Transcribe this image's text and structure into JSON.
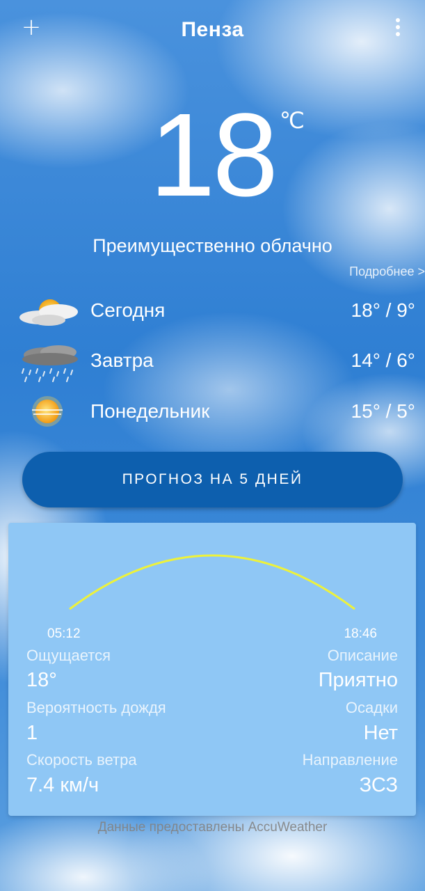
{
  "header": {
    "add_label": "+",
    "city": "Пенза"
  },
  "current": {
    "temperature": "18",
    "unit": "℃",
    "condition": "Преимущественно облачно",
    "details_link": "Подробнее >"
  },
  "forecast": [
    {
      "day": "Сегодня",
      "range": "18° / 9°",
      "icon": "partly-cloudy-sun-icon"
    },
    {
      "day": "Завтра",
      "range": "14° / 6°",
      "icon": "rain-cloud-icon"
    },
    {
      "day": "Понедельник",
      "range": "15° / 5°",
      "icon": "hazy-sun-icon"
    }
  ],
  "forecast_button_label": "ПРОГНОЗ НА 5 ДНЕЙ",
  "details": {
    "sunrise": "05:12",
    "sunset": "18:46",
    "feels_like_label": "Ощущается",
    "feels_like_value": "18°",
    "description_label": "Описание",
    "description_value": "Приятно",
    "rain_chance_label": "Вероятность дождя",
    "rain_chance_value": "1",
    "precip_label": "Осадки",
    "precip_value": "Нет",
    "wind_speed_label": "Скорость ветра",
    "wind_speed_value": "7.4 км/ч",
    "wind_dir_label": "Направление",
    "wind_dir_value": "ЗСЗ"
  },
  "credit": "Данные предоставлены AccuWeather",
  "colors": {
    "button": "#0d5fae",
    "card": "#8fc7f5",
    "sun_arc": "#eef23a"
  }
}
